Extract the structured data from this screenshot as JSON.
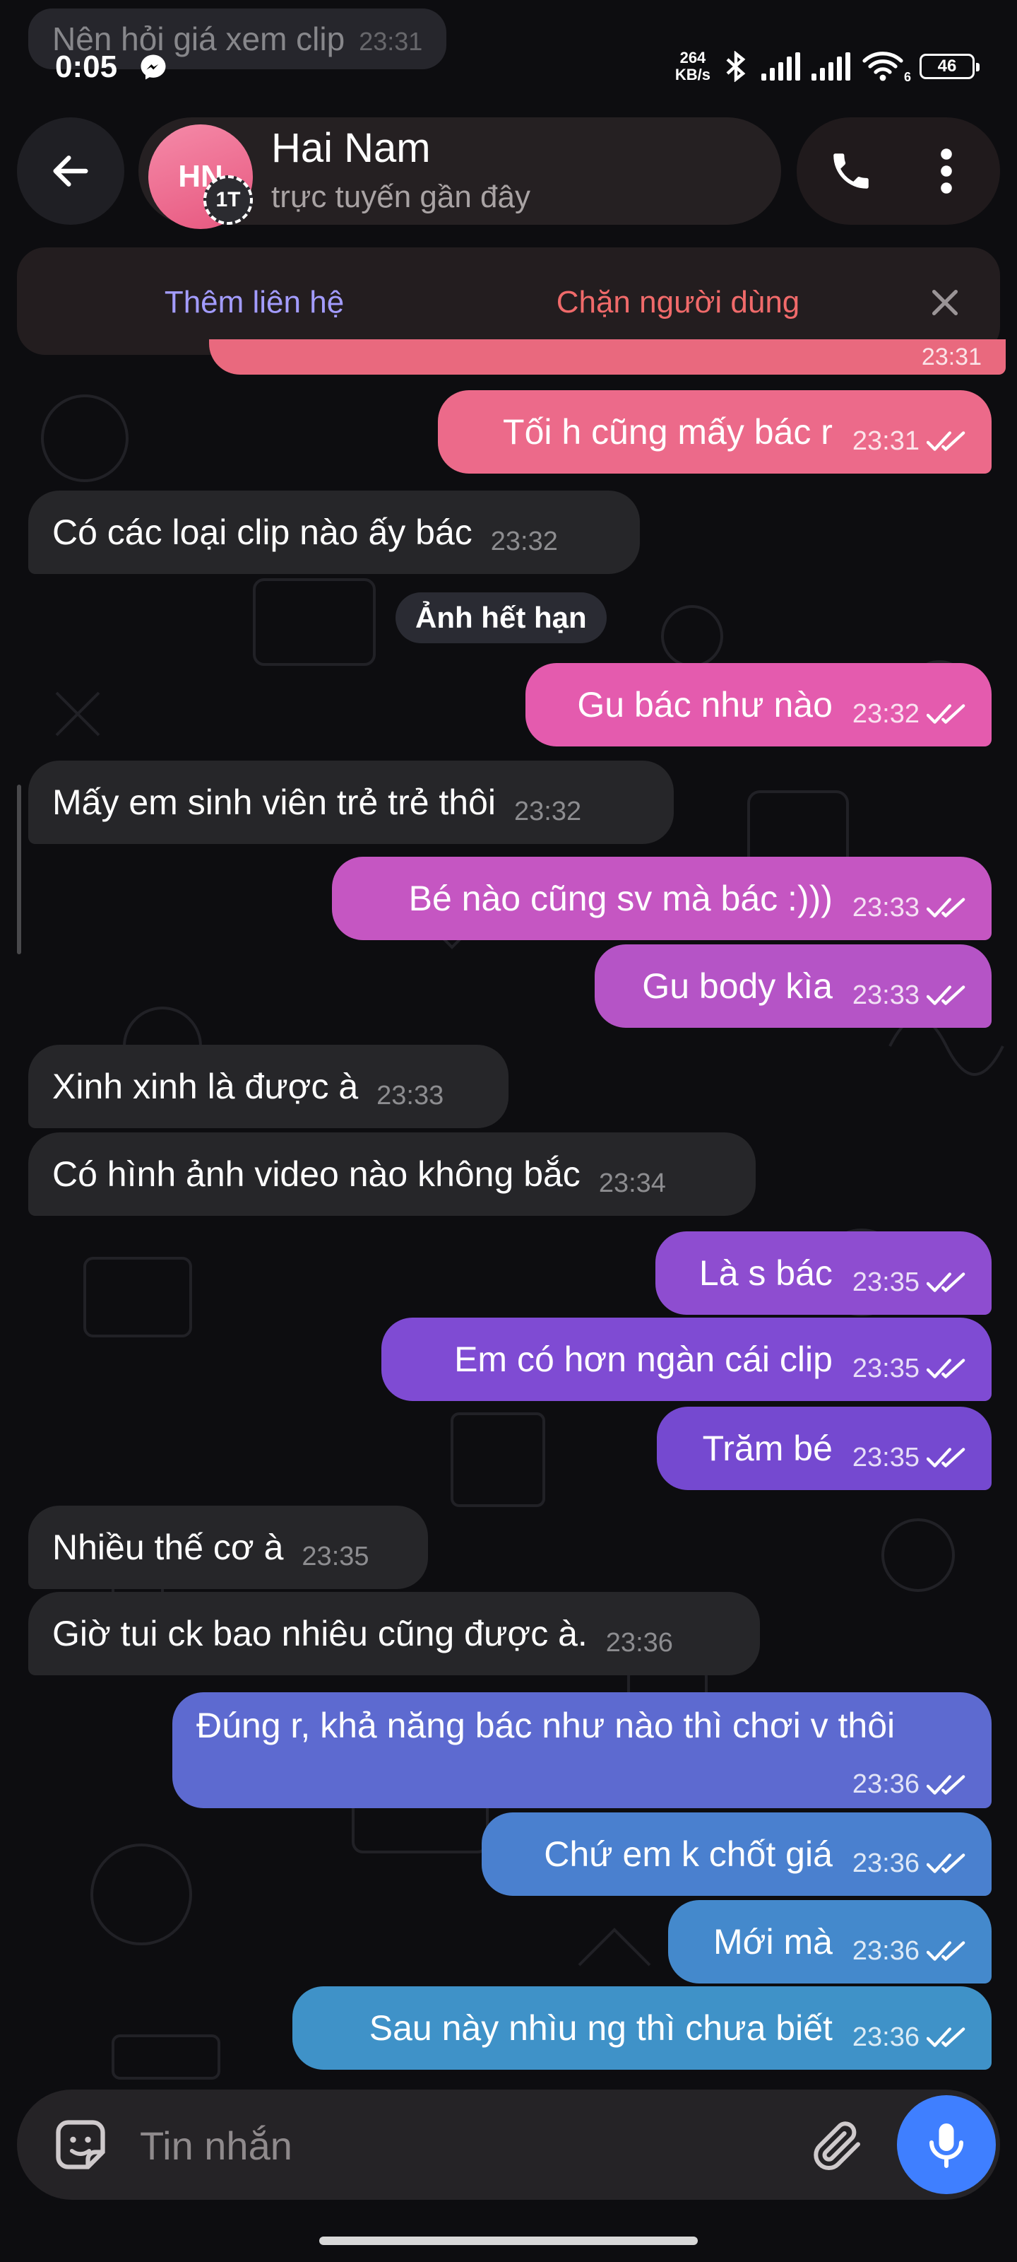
{
  "status_bar": {
    "time": "0:05",
    "net_speed_value": "264",
    "net_speed_unit": "KB/s",
    "battery": "46",
    "wifi_badge": "6"
  },
  "ghost_message": {
    "text": "Nên hỏi giá xem clip",
    "time": "23:31"
  },
  "header": {
    "avatar_initials": "HN",
    "avatar_badge": "1T",
    "contact_name": "Hai Nam",
    "contact_status": "trực tuyến gần đây"
  },
  "contact_bar": {
    "add_label": "Thêm liên hệ",
    "block_label": "Chặn người dùng"
  },
  "chat": {
    "partial_time": "23:31",
    "date_chip": "Ảnh hết hạn",
    "messages": [
      {
        "dir": "out",
        "text": "Tối h cũng mấy bác r",
        "time": "23:31",
        "color": "#ec6a8a"
      },
      {
        "dir": "in",
        "text": "Có các loại clip nào ấy bác",
        "time": "23:32"
      },
      {
        "dir": "out",
        "text": "Gu bác như nào",
        "time": "23:32",
        "color": "#e45bae"
      },
      {
        "dir": "in",
        "text": "Mấy em sinh viên trẻ trẻ thôi",
        "time": "23:32"
      },
      {
        "dir": "out",
        "text": "Bé nào cũng sv mà bác :)))",
        "time": "23:33",
        "color": "#c556c2"
      },
      {
        "dir": "out",
        "text": "Gu body kìa",
        "time": "23:33",
        "color": "#b554c6"
      },
      {
        "dir": "in",
        "text": "Xinh xinh là được à",
        "time": "23:33"
      },
      {
        "dir": "in",
        "text": "Có hình ảnh video nào không bắc",
        "time": "23:34"
      },
      {
        "dir": "out",
        "text": "Là s bác",
        "time": "23:35",
        "color": "#8e4dd0"
      },
      {
        "dir": "out",
        "text": "Em có hơn ngàn cái clip",
        "time": "23:35",
        "color": "#7f4bd3"
      },
      {
        "dir": "out",
        "text": "Trăm bé",
        "time": "23:35",
        "color": "#7549d0"
      },
      {
        "dir": "in",
        "text": "Nhiều thế cơ à",
        "time": "23:35"
      },
      {
        "dir": "in",
        "text": "Giờ tui ck bao nhiêu cũng được à.",
        "time": "23:36"
      },
      {
        "dir": "out",
        "text": "Đúng r, khả năng bác như nào thì chơi v thôi",
        "time": "23:36",
        "color": "#5d6ad0"
      },
      {
        "dir": "out",
        "text": "Chứ em k chốt giá",
        "time": "23:36",
        "color": "#4a80cf"
      },
      {
        "dir": "out",
        "text": "Mới mà",
        "time": "23:36",
        "color": "#4489cc"
      },
      {
        "dir": "out",
        "text": "Sau này nhìu ng thì chưa biết",
        "time": "23:36",
        "color": "#3f92c8"
      }
    ]
  },
  "composer": {
    "placeholder": "Tin nhắn"
  },
  "icons": {
    "back": "arrow-left-icon",
    "call": "phone-icon",
    "more": "more-vertical-icon",
    "close": "close-icon",
    "sticker": "sticker-icon",
    "attach": "paperclip-icon",
    "mic": "microphone-icon",
    "read": "double-check-icon"
  }
}
